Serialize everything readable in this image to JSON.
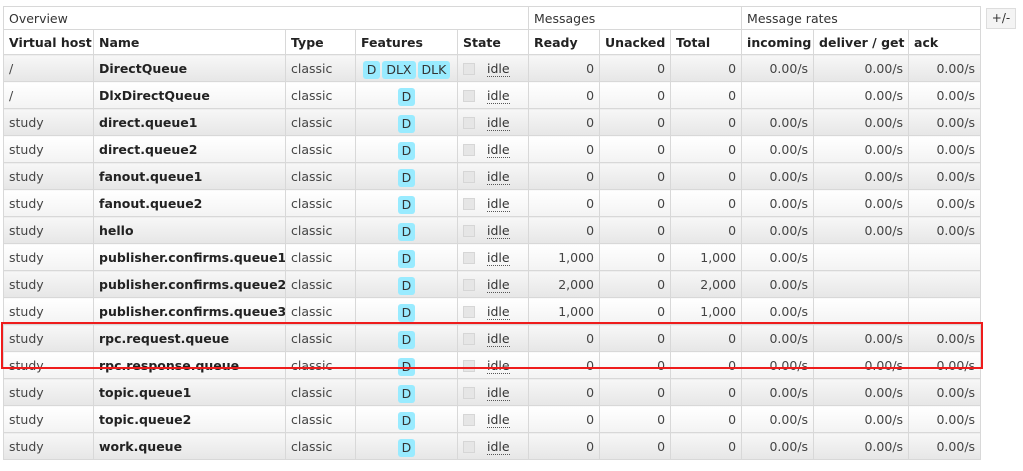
{
  "groups": {
    "overview": "Overview",
    "messages": "Messages",
    "message_rates": "Message rates"
  },
  "columns": {
    "vhost": "Virtual host",
    "name": "Name",
    "type": "Type",
    "features": "Features",
    "state": "State",
    "ready": "Ready",
    "unacked": "Unacked",
    "total": "Total",
    "incoming": "incoming",
    "deliver": "deliver / get",
    "ack": "ack"
  },
  "toggle_label": "+/-",
  "rows": [
    {
      "vhost": "/",
      "name": "DirectQueue",
      "type": "classic",
      "tags": [
        "D",
        "DLX",
        "DLK"
      ],
      "state": "idle",
      "ready": "0",
      "unacked": "0",
      "total": "0",
      "incoming": "0.00/s",
      "deliver": "0.00/s",
      "ack": "0.00/s"
    },
    {
      "vhost": "/",
      "name": "DlxDirectQueue",
      "type": "classic",
      "tags": [
        "D"
      ],
      "state": "idle",
      "ready": "0",
      "unacked": "0",
      "total": "0",
      "incoming": "",
      "deliver": "0.00/s",
      "ack": "0.00/s"
    },
    {
      "vhost": "study",
      "name": "direct.queue1",
      "type": "classic",
      "tags": [
        "D"
      ],
      "state": "idle",
      "ready": "0",
      "unacked": "0",
      "total": "0",
      "incoming": "0.00/s",
      "deliver": "0.00/s",
      "ack": "0.00/s"
    },
    {
      "vhost": "study",
      "name": "direct.queue2",
      "type": "classic",
      "tags": [
        "D"
      ],
      "state": "idle",
      "ready": "0",
      "unacked": "0",
      "total": "0",
      "incoming": "0.00/s",
      "deliver": "0.00/s",
      "ack": "0.00/s"
    },
    {
      "vhost": "study",
      "name": "fanout.queue1",
      "type": "classic",
      "tags": [
        "D"
      ],
      "state": "idle",
      "ready": "0",
      "unacked": "0",
      "total": "0",
      "incoming": "0.00/s",
      "deliver": "0.00/s",
      "ack": "0.00/s"
    },
    {
      "vhost": "study",
      "name": "fanout.queue2",
      "type": "classic",
      "tags": [
        "D"
      ],
      "state": "idle",
      "ready": "0",
      "unacked": "0",
      "total": "0",
      "incoming": "0.00/s",
      "deliver": "0.00/s",
      "ack": "0.00/s"
    },
    {
      "vhost": "study",
      "name": "hello",
      "type": "classic",
      "tags": [
        "D"
      ],
      "state": "idle",
      "ready": "0",
      "unacked": "0",
      "total": "0",
      "incoming": "0.00/s",
      "deliver": "0.00/s",
      "ack": "0.00/s"
    },
    {
      "vhost": "study",
      "name": "publisher.confirms.queue1",
      "type": "classic",
      "tags": [
        "D"
      ],
      "state": "idle",
      "ready": "1,000",
      "unacked": "0",
      "total": "1,000",
      "incoming": "0.00/s",
      "deliver": "",
      "ack": ""
    },
    {
      "vhost": "study",
      "name": "publisher.confirms.queue2",
      "type": "classic",
      "tags": [
        "D"
      ],
      "state": "idle",
      "ready": "2,000",
      "unacked": "0",
      "total": "2,000",
      "incoming": "0.00/s",
      "deliver": "",
      "ack": ""
    },
    {
      "vhost": "study",
      "name": "publisher.confirms.queue3",
      "type": "classic",
      "tags": [
        "D"
      ],
      "state": "idle",
      "ready": "1,000",
      "unacked": "0",
      "total": "1,000",
      "incoming": "0.00/s",
      "deliver": "",
      "ack": ""
    },
    {
      "vhost": "study",
      "name": "rpc.request.queue",
      "type": "classic",
      "tags": [
        "D"
      ],
      "state": "idle",
      "ready": "0",
      "unacked": "0",
      "total": "0",
      "incoming": "0.00/s",
      "deliver": "0.00/s",
      "ack": "0.00/s"
    },
    {
      "vhost": "study",
      "name": "rpc.response.queue",
      "type": "classic",
      "tags": [
        "D"
      ],
      "state": "idle",
      "ready": "0",
      "unacked": "0",
      "total": "0",
      "incoming": "0.00/s",
      "deliver": "0.00/s",
      "ack": "0.00/s"
    },
    {
      "vhost": "study",
      "name": "topic.queue1",
      "type": "classic",
      "tags": [
        "D"
      ],
      "state": "idle",
      "ready": "0",
      "unacked": "0",
      "total": "0",
      "incoming": "0.00/s",
      "deliver": "0.00/s",
      "ack": "0.00/s"
    },
    {
      "vhost": "study",
      "name": "topic.queue2",
      "type": "classic",
      "tags": [
        "D"
      ],
      "state": "idle",
      "ready": "0",
      "unacked": "0",
      "total": "0",
      "incoming": "0.00/s",
      "deliver": "0.00/s",
      "ack": "0.00/s"
    },
    {
      "vhost": "study",
      "name": "work.queue",
      "type": "classic",
      "tags": [
        "D"
      ],
      "state": "idle",
      "ready": "0",
      "unacked": "0",
      "total": "0",
      "incoming": "0.00/s",
      "deliver": "0.00/s",
      "ack": "0.00/s"
    }
  ],
  "colors": {
    "tag_bg": "#99ebff",
    "highlight_border": "#ee1c1c",
    "row_border": "#d8d8d8"
  }
}
